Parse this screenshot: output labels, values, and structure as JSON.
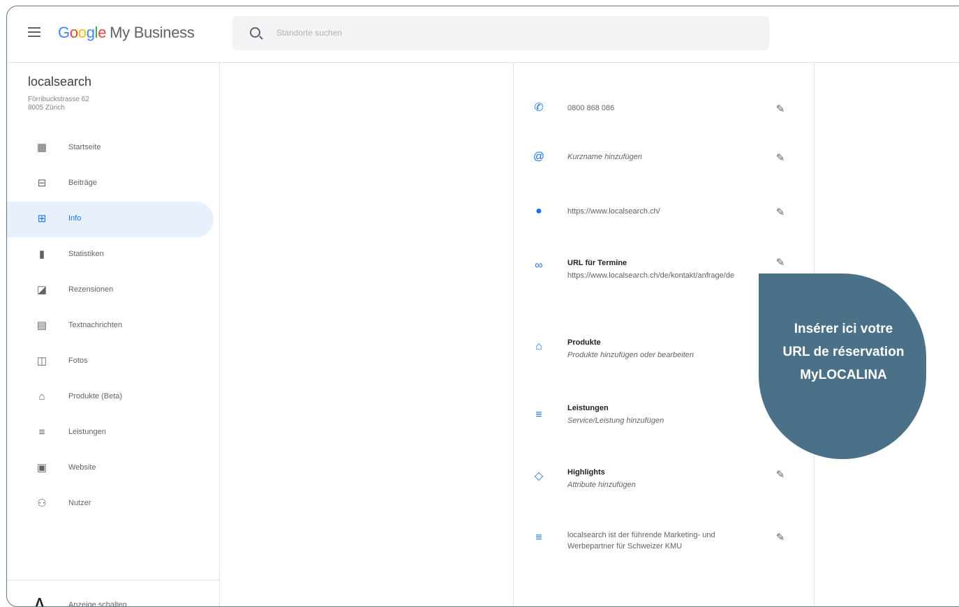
{
  "header": {
    "app_title_letters": [
      "G",
      "o",
      "o",
      "g",
      "l",
      "e"
    ],
    "app_title_suffix": "My Business",
    "search_placeholder": "Standorte suchen"
  },
  "business": {
    "name": "localsearch",
    "address": "Förribuckstrasse 62\n8005 Zürich"
  },
  "sidebar": {
    "items": [
      {
        "label": "Startseite",
        "icon": "dashboard-icon"
      },
      {
        "label": "Beiträge",
        "icon": "posts-icon"
      },
      {
        "label": "Info",
        "icon": "storefront-icon",
        "active": true
      },
      {
        "label": "Statistiken",
        "icon": "bar-chart-icon"
      },
      {
        "label": "Rezensionen",
        "icon": "reviews-icon"
      },
      {
        "label": "Textnachrichten",
        "icon": "messages-icon"
      },
      {
        "label": "Fotos",
        "icon": "photos-icon"
      },
      {
        "label": "Produkte (Beta)",
        "icon": "basket-icon"
      },
      {
        "label": "Leistungen",
        "icon": "list-icon"
      },
      {
        "label": "Website",
        "icon": "website-icon"
      },
      {
        "label": "Nutzer",
        "icon": "add-user-icon"
      }
    ],
    "ads_label": "Anzeige schalten"
  },
  "info": {
    "phone": "0800 868 086",
    "shortname": "Kurzname hinzufügen",
    "website": "https://www.localsearch.ch/",
    "appointment_title": "URL für Termine",
    "appointment_url": "https://www.localsearch.ch/de/kontakt/anfrage/de",
    "products_title": "Produkte",
    "products_text": "Produkte hinzufügen oder bearbeiten",
    "services_title": "Leistungen",
    "services_text": "Service/Leistung hinzufügen",
    "highlights_title": "Highlights",
    "highlights_text": "Attribute hinzufügen",
    "description": "localsearch ist der führende Marketing- und Werbepartner für Schweizer KMU"
  },
  "callout": {
    "line1": "Insérer ici votre",
    "line2": "URL de réservation",
    "line3": "MyLOCALINA"
  },
  "colors": {
    "accent": "#1a73e8",
    "callout": "#4b7189",
    "frame": "#5a7a90"
  }
}
